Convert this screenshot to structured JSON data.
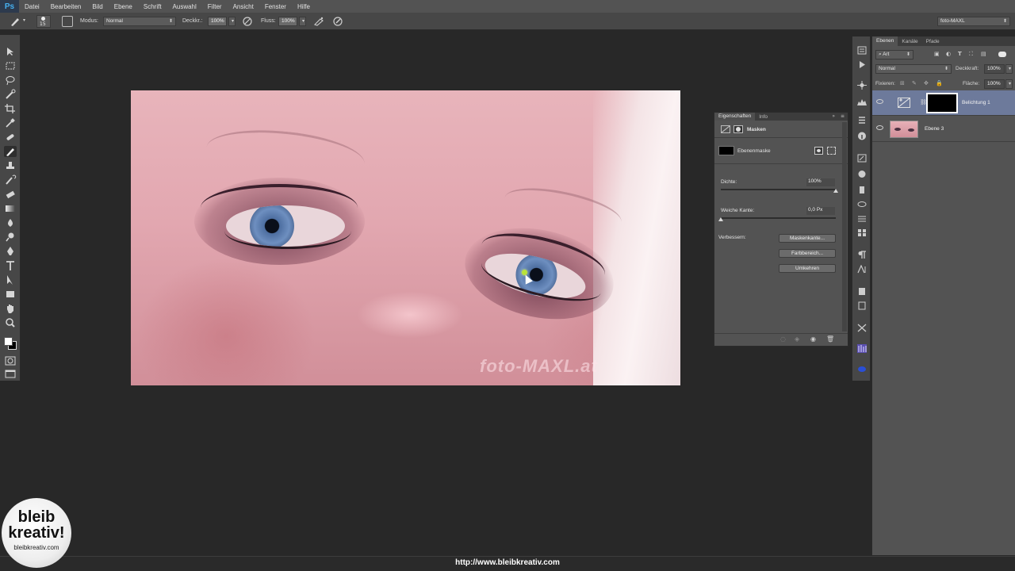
{
  "app": {
    "logo": "Ps"
  },
  "menu": [
    "Datei",
    "Bearbeiten",
    "Bild",
    "Ebene",
    "Schrift",
    "Auswahl",
    "Filter",
    "Ansicht",
    "Fenster",
    "Hilfe"
  ],
  "options": {
    "brush_size": "15",
    "mode_label": "Modus:",
    "mode_value": "Normal",
    "opacity_label": "Deckkr.:",
    "opacity_value": "100%",
    "flow_label": "Fluss:",
    "flow_value": "100%",
    "workspace": "foto-MAXL"
  },
  "properties": {
    "tabs": [
      "Eigenschaften",
      "Info"
    ],
    "title": "Masken",
    "mask_type": "Ebenenmaske",
    "density_label": "Dichte:",
    "density_value": "100%",
    "density_fraction": 1.0,
    "feather_label": "Weiche Kante:",
    "feather_value": "0,0 Px",
    "feather_fraction": 0.0,
    "refine_label": "Verbessern:",
    "buttons": [
      "Maskenkante...",
      "Farbbereich...",
      "Umkehren"
    ]
  },
  "canvas": {
    "watermark": "foto-MAXL.at"
  },
  "layers": {
    "tabs": [
      "Ebenen",
      "Kanäle",
      "Pfade"
    ],
    "filter_kind": "Art",
    "blend_mode": "Normal",
    "opacity_label": "Deckkraft:",
    "opacity_value": "100%",
    "lock_label": "Fixieren:",
    "fill_label": "Fläche:",
    "fill_value": "100%",
    "items": [
      {
        "name": "Belichtung 1",
        "selected": true
      },
      {
        "name": "Ebene 3",
        "selected": false
      }
    ]
  },
  "footer": {
    "url": "http://www.bleibkreativ.com",
    "logo_line1": "bleib",
    "logo_line2": "kreativ!",
    "logo_line3": "bleibkreativ.com"
  },
  "colors": {
    "accent_selected": "#6d7a9b",
    "ps_blue": "#46b0f0"
  }
}
